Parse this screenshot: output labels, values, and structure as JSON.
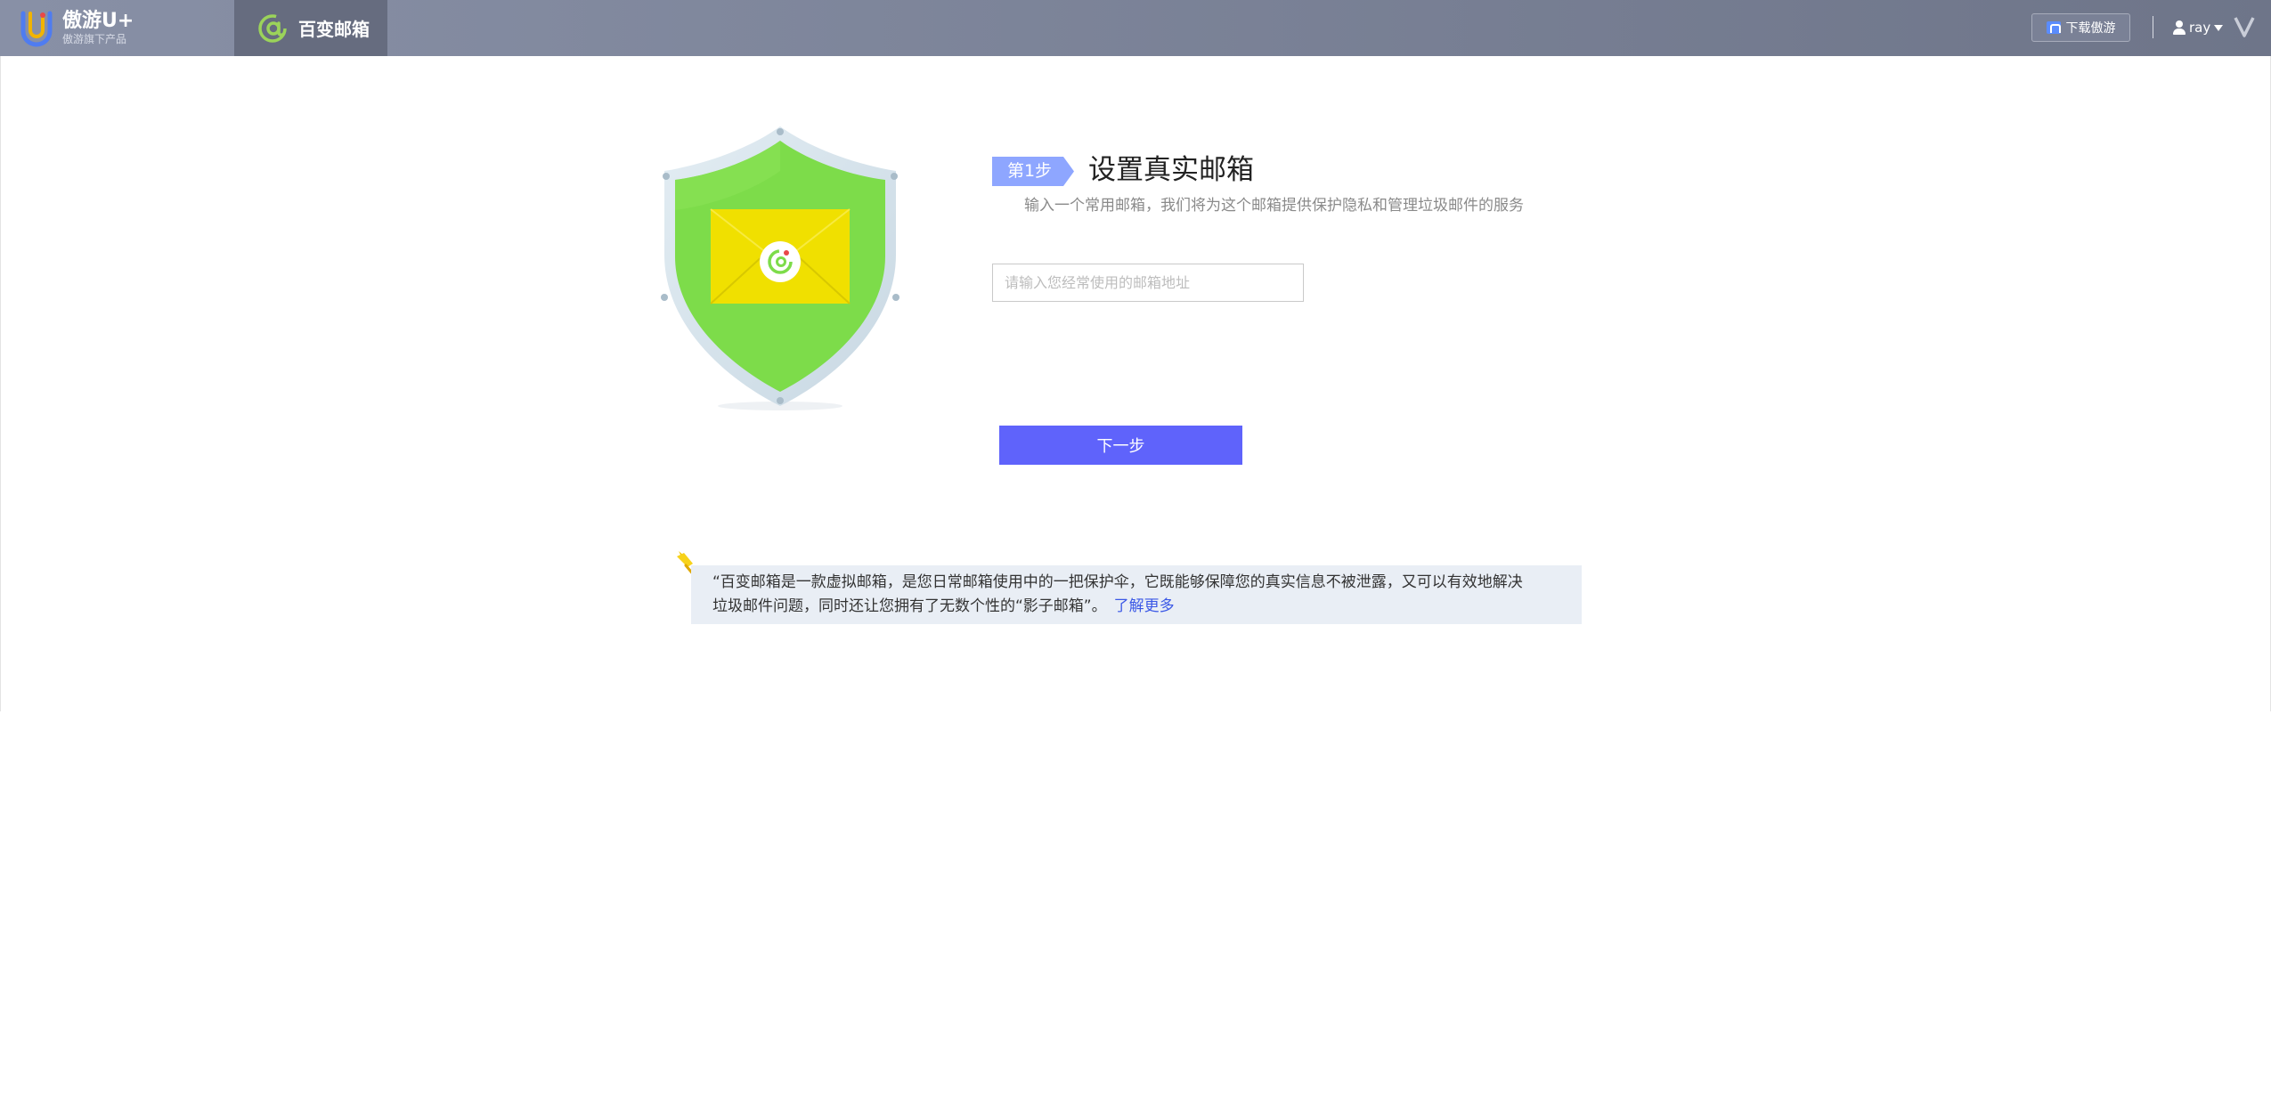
{
  "header": {
    "logo_title": "傲游U+",
    "logo_subtitle": "傲游旗下产品",
    "app_tab_label": "百变邮箱",
    "download_label": "下载傲游",
    "user_name": "ray",
    "vip_badge": "V"
  },
  "main": {
    "step_badge": "第1步",
    "step_title": "设置真实邮箱",
    "step_description": "输入一个常用邮箱，我们将为这个邮箱提供保护隐私和管理垃圾邮件的服务",
    "email_input_placeholder": "请输入您经常使用的邮箱地址",
    "email_input_value": "",
    "next_button_label": "下一步"
  },
  "note": {
    "text_line1": "“百变邮箱是一款虚拟邮箱，是您日常邮箱使用中的一把保护伞，它既能够保障您的真实信息不被泄露，又可以有效地解决",
    "text_line2": "垃圾邮件问题，同时还让您拥有了无数个性的“影子邮箱”。",
    "learn_more_label": "了解更多"
  },
  "colors": {
    "header_bg": "#7a8196",
    "accent_blue": "#5f63fb",
    "step_badge_bg": "#8ea6ff",
    "shield_green": "#7ddc4a",
    "envelope_yellow": "#f0e000",
    "note_bg": "#e9eef5",
    "link_blue": "#3b58e6"
  },
  "icons": {
    "logo": "maxthon-u-logo-icon",
    "app": "at-mail-icon",
    "download": "download-icon",
    "user": "user-icon",
    "caret": "caret-down-icon",
    "vip": "vip-icon",
    "shield": "shield-envelope-icon",
    "pin": "pin-icon"
  }
}
